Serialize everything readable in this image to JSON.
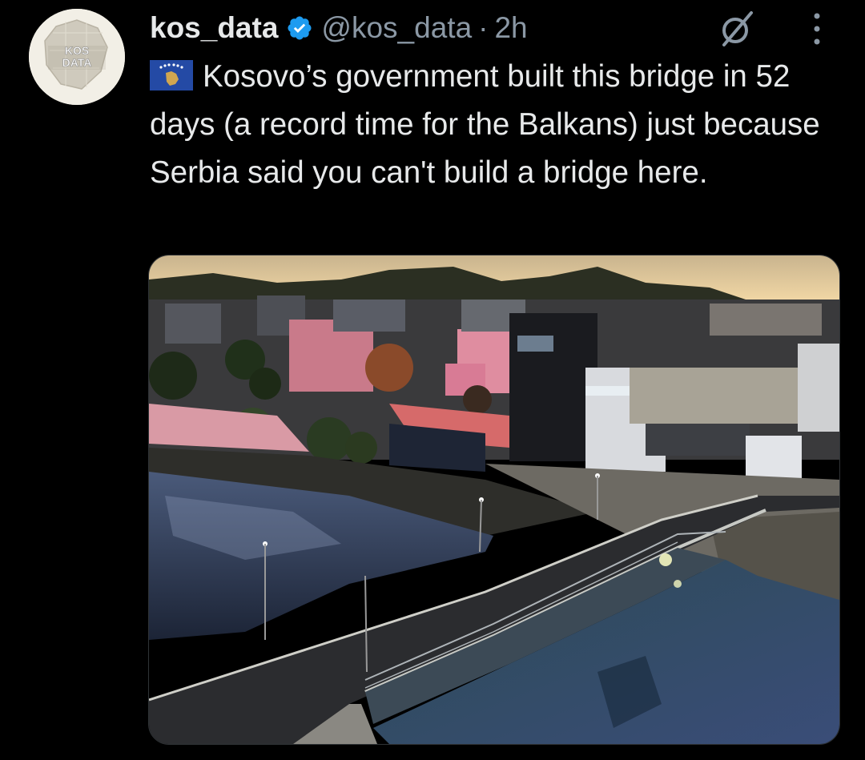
{
  "author": {
    "display_name": "kos_data",
    "handle": "@kos_data",
    "separator": "·",
    "time": "2h",
    "verified": true,
    "avatar_text_line1": "KOS",
    "avatar_text_line2": "DATA"
  },
  "tweet": {
    "text": "Kosovo’s government built this bridge in 52 days (a record time for the Balkans) just because Serbia said you can't build a bridge here.",
    "flag_icon": "kosovo-flag-icon"
  },
  "actions": {
    "grok_icon": "grok-icon",
    "more_icon": "more-vertical-icon"
  },
  "media": {
    "type": "photo"
  },
  "colors": {
    "background": "#000000",
    "text": "#e7e9ea",
    "secondary_text": "#8b98a5",
    "verified_blue": "#1d9bf0",
    "kosovo_flag_blue": "#244aa5",
    "kosovo_flag_gold": "#d0a650"
  }
}
